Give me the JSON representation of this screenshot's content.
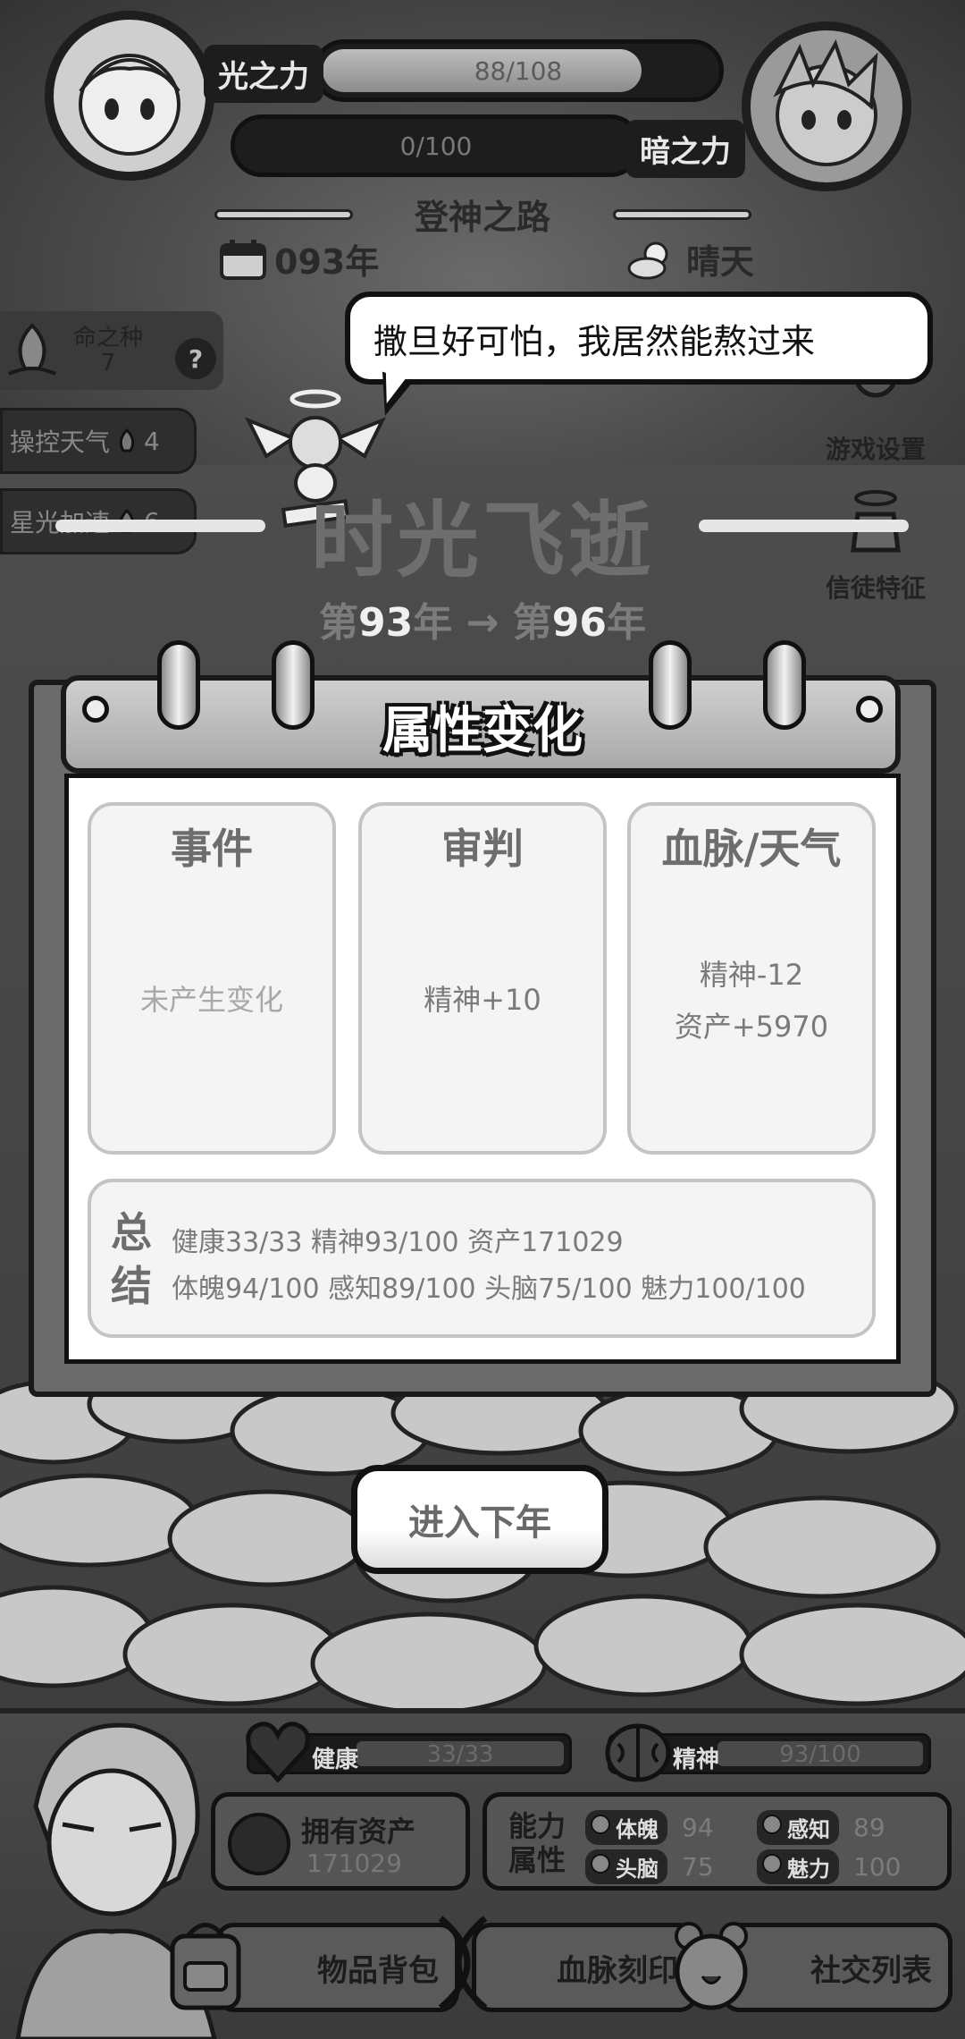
{
  "top": {
    "light_label": "光之力",
    "light_value": "88/108",
    "light_fraction": 0.815,
    "dark_label": "暗之力",
    "dark_value": "0/100",
    "dark_fraction": 0.0,
    "road_title": "登神之路",
    "year": "093年",
    "weather": "晴天"
  },
  "side": {
    "seed_label": "命之种",
    "seed_count": "7",
    "help_glyph": "?",
    "weather_btn": "操控天气",
    "weather_cost": "4",
    "star_btn": "星光加速",
    "star_cost": "6",
    "settings": "游戏设置",
    "believer": "信徒特征"
  },
  "bubble_text": "撒旦好可怕，我居然能熬过来",
  "time": {
    "title": "时光飞逝",
    "from_prefix": "第",
    "from_num": "93",
    "from_suffix": "年",
    "arrow": "→",
    "to_prefix": "第",
    "to_num": "96",
    "to_suffix": "年"
  },
  "panel": {
    "title": "属性变化",
    "columns": [
      {
        "title": "事件",
        "lines": [
          "未产生变化"
        ]
      },
      {
        "title": "审判",
        "lines": [
          "精神+10"
        ]
      },
      {
        "title": "血脉/天气",
        "lines": [
          "精神-12",
          "资产+5970"
        ]
      }
    ],
    "summary_label_1": "总",
    "summary_label_2": "结",
    "summary_line_1": "健康33/33  精神93/100  资产171029",
    "summary_line_2": "体魄94/100  感知89/100  头脑75/100  魅力100/100"
  },
  "next_button": "进入下年",
  "bottom": {
    "health_label": "健康",
    "health_value": "33/33",
    "spirit_label": "精神",
    "spirit_value": "93/100",
    "assets_label": "拥有资产",
    "assets_value": "171029",
    "attr_label": "能力属性",
    "attrs": [
      {
        "name": "体魄",
        "value": "94"
      },
      {
        "name": "感知",
        "value": "89"
      },
      {
        "name": "头脑",
        "value": "75"
      },
      {
        "name": "魅力",
        "value": "100"
      }
    ],
    "nav": {
      "bag": "物品背包",
      "blood": "血脉刻印",
      "social": "社交列表"
    }
  },
  "colors": {
    "accent_light": "#bdbdbd",
    "dark_outline": "#111111",
    "panel_bg": "#ffffff"
  }
}
